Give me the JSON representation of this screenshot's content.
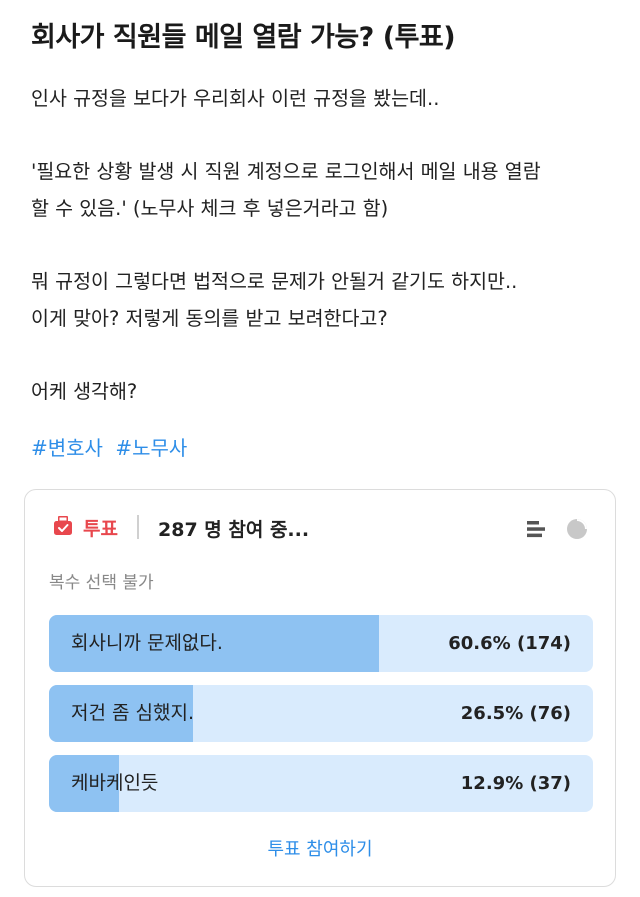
{
  "post": {
    "title": "회사가 직원들 메일 열람 가능? (투표)",
    "paragraphs": [
      [
        "인사 규정을 보다가 우리회사 이런 규정을 봤는데.."
      ],
      [
        "'필요한 상황 발생 시 직원 계정으로 로그인해서 메일 내용 열람",
        "할 수 있음.'  (노무사 체크 후 넣은거라고 함)"
      ],
      [
        "뭐 규정이 그렇다면 법적으로 문제가 안될거 같기도 하지만..",
        "이게 맞아? 저렇게 동의를 받고 보려한다고?"
      ],
      [
        "어케 생각해?"
      ]
    ],
    "hashtags": [
      "#변호사",
      "#노무사"
    ]
  },
  "poll": {
    "label": "투표",
    "participants": "287 명 참여 중...",
    "note": "복수 선택 불가",
    "icons": {
      "poll": "ballot-box-icon",
      "list": "bar-list-icon",
      "chart": "pie-chart-icon"
    },
    "options": [
      {
        "text": "회사니까 문제없다.",
        "percent": 60.6,
        "result": "60.6% (174)"
      },
      {
        "text": "저건 좀 심했지.",
        "percent": 26.5,
        "result": "26.5% (76)"
      },
      {
        "text": "케바케인듯",
        "percent": 12.9,
        "result": "12.9% (37)"
      }
    ],
    "vote_button": "투표 참여하기"
  },
  "colors": {
    "accent_blue": "#2e8ee8",
    "poll_red": "#e8474d",
    "bar_fill": "#8ec2f2",
    "bar_track": "#d9ebfd"
  }
}
